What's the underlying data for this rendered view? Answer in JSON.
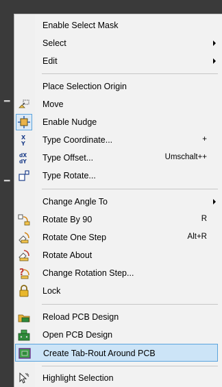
{
  "menu": {
    "items": [
      {
        "label": "Enable Select Mask"
      },
      {
        "label": "Select"
      },
      {
        "label": "Edit"
      },
      {
        "label": "Place Selection Origin"
      },
      {
        "label": "Move",
        "icon": "move-icon"
      },
      {
        "label": "Enable Nudge",
        "icon": "nudge-icon"
      },
      {
        "label": "Type Coordinate...",
        "shortcut": "+",
        "icon": "xy-icon"
      },
      {
        "label": "Type Offset...",
        "shortcut": "Umschalt++",
        "icon": "dxdy-icon"
      },
      {
        "label": "Type Rotate...",
        "icon": "type-rotate-icon"
      },
      {
        "label": "Change Angle To"
      },
      {
        "label": "Rotate By 90",
        "shortcut": "R",
        "icon": "rotate-90-icon"
      },
      {
        "label": "Rotate One Step",
        "shortcut": "Alt+R",
        "icon": "rotate-step-icon"
      },
      {
        "label": "Rotate About",
        "icon": "rotate-about-icon"
      },
      {
        "label": "Change Rotation Step...",
        "icon": "rotation-step-icon"
      },
      {
        "label": "Lock",
        "icon": "lock-icon"
      },
      {
        "label": "Reload PCB Design",
        "icon": "reload-pcb-icon"
      },
      {
        "label": "Open PCB Design",
        "icon": "open-pcb-icon"
      },
      {
        "label": "Create Tab-Rout Around PCB",
        "icon": "tab-rout-icon"
      },
      {
        "label": "Highlight Selection",
        "icon": "highlight-selection-icon"
      }
    ]
  },
  "colors": {
    "menu_background": "#f2f2f2",
    "highlight_background": "#cce4f7",
    "highlight_border": "#5aa3dd",
    "separator": "#c6c6c6",
    "backdrop": "#3a3a3a"
  }
}
